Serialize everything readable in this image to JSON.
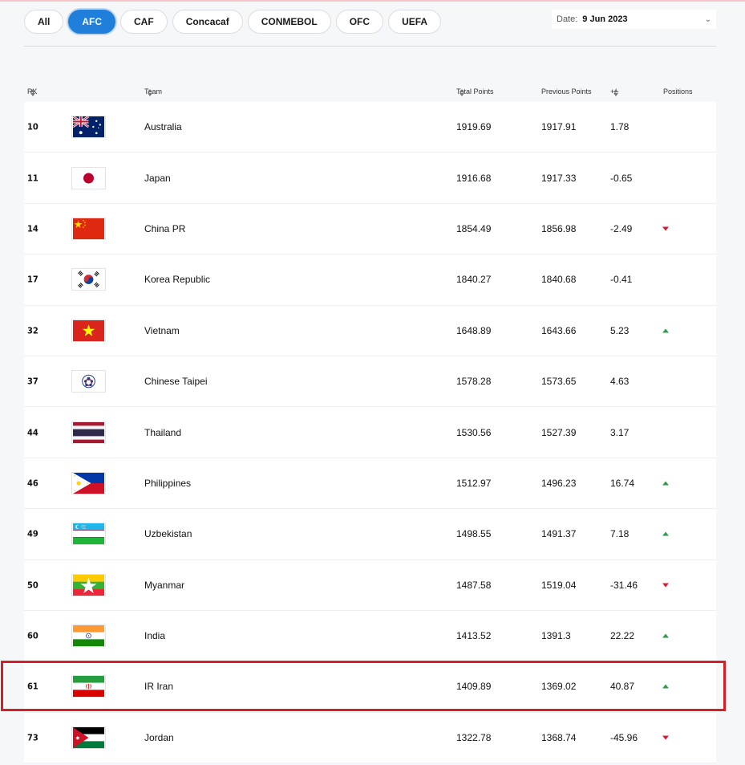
{
  "filters": [
    {
      "label": "All",
      "active": false
    },
    {
      "label": "AFC",
      "active": true
    },
    {
      "label": "CAF",
      "active": false
    },
    {
      "label": "Concacaf",
      "active": false
    },
    {
      "label": "CONMEBOL",
      "active": false
    },
    {
      "label": "OFC",
      "active": false
    },
    {
      "label": "UEFA",
      "active": false
    }
  ],
  "date": {
    "label": "Date:",
    "value": "9 Jun 2023"
  },
  "columns": {
    "rk": "RK",
    "team": "Team",
    "total": "Total Points",
    "previous": "Previous Points",
    "diff": "+/-",
    "positions": "Positions"
  },
  "rows": [
    {
      "rk": "10",
      "team": "Australia",
      "flag": "australia-flag-icon",
      "total": "1919.69",
      "previous": "1917.91",
      "diff": "1.78",
      "trend": ""
    },
    {
      "rk": "11",
      "team": "Japan",
      "flag": "japan-flag-icon",
      "total": "1916.68",
      "previous": "1917.33",
      "diff": "-0.65",
      "trend": ""
    },
    {
      "rk": "14",
      "team": "China PR",
      "flag": "china-flag-icon",
      "total": "1854.49",
      "previous": "1856.98",
      "diff": "-2.49",
      "trend": "down"
    },
    {
      "rk": "17",
      "team": "Korea Republic",
      "flag": "korea-flag-icon",
      "total": "1840.27",
      "previous": "1840.68",
      "diff": "-0.41",
      "trend": ""
    },
    {
      "rk": "32",
      "team": "Vietnam",
      "flag": "vietnam-flag-icon",
      "total": "1648.89",
      "previous": "1643.66",
      "diff": "5.23",
      "trend": "up"
    },
    {
      "rk": "37",
      "team": "Chinese Taipei",
      "flag": "chinese-taipei-flag-icon",
      "total": "1578.28",
      "previous": "1573.65",
      "diff": "4.63",
      "trend": ""
    },
    {
      "rk": "44",
      "team": "Thailand",
      "flag": "thailand-flag-icon",
      "total": "1530.56",
      "previous": "1527.39",
      "diff": "3.17",
      "trend": ""
    },
    {
      "rk": "46",
      "team": "Philippines",
      "flag": "philippines-flag-icon",
      "total": "1512.97",
      "previous": "1496.23",
      "diff": "16.74",
      "trend": "up"
    },
    {
      "rk": "49",
      "team": "Uzbekistan",
      "flag": "uzbekistan-flag-icon",
      "total": "1498.55",
      "previous": "1491.37",
      "diff": "7.18",
      "trend": "up"
    },
    {
      "rk": "50",
      "team": "Myanmar",
      "flag": "myanmar-flag-icon",
      "total": "1487.58",
      "previous": "1519.04",
      "diff": "-31.46",
      "trend": "down"
    },
    {
      "rk": "60",
      "team": "India",
      "flag": "india-flag-icon",
      "total": "1413.52",
      "previous": "1391.3",
      "diff": "22.22",
      "trend": "up"
    },
    {
      "rk": "61",
      "team": "IR Iran",
      "flag": "iran-flag-icon",
      "total": "1409.89",
      "previous": "1369.02",
      "diff": "40.87",
      "trend": "up"
    },
    {
      "rk": "73",
      "team": "Jordan",
      "flag": "jordan-flag-icon",
      "total": "1322.78",
      "previous": "1368.74",
      "diff": "-45.96",
      "trend": "down"
    }
  ]
}
